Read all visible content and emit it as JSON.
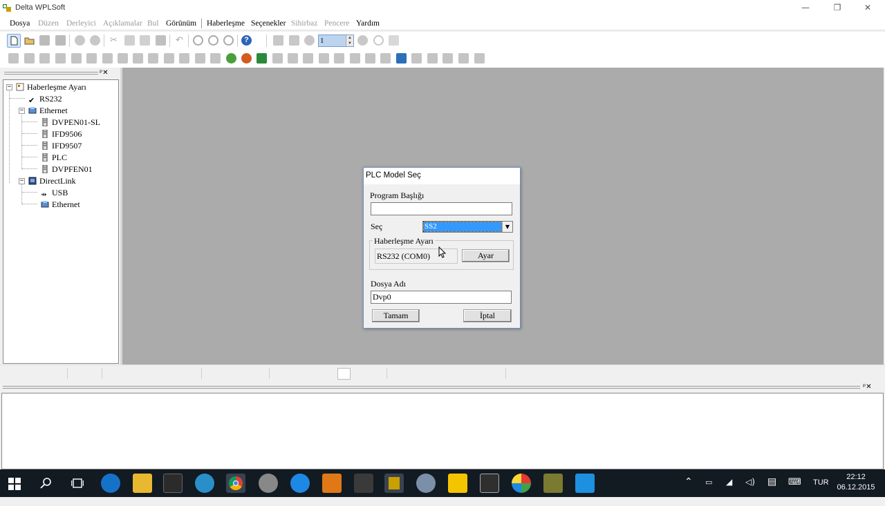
{
  "window": {
    "title": "Delta WPLSoft",
    "minimize": "—",
    "restore": "❐",
    "close": "✕"
  },
  "menubar": [
    {
      "label": "Dosya",
      "enabled": true
    },
    {
      "label": "Düzen",
      "enabled": false
    },
    {
      "label": "Derleyici",
      "enabled": false
    },
    {
      "label": "Açıklamalar",
      "enabled": false
    },
    {
      "label": "Bul",
      "enabled": false
    },
    {
      "label": "Görünüm",
      "enabled": true
    },
    {
      "label": "Haberleşme",
      "enabled": true
    },
    {
      "label": "Seçenekler",
      "enabled": true
    },
    {
      "label": "Sihirbaz",
      "enabled": false
    },
    {
      "label": "Pencere",
      "enabled": false
    },
    {
      "label": "Yardım",
      "enabled": true
    }
  ],
  "toolbar": {
    "spin_value": "1",
    "help_icon": "?"
  },
  "left_pane": {
    "pin": "ᵖ✕",
    "tree": {
      "root": "Haberleşme Ayarı",
      "rs232": "RS232",
      "ethernet": "Ethernet",
      "ethernet_children": [
        "DVPEN01-SL",
        "IFD9506",
        "IFD9507",
        "PLC",
        "DVPFEN01"
      ],
      "directlink": "DirectLink",
      "directlink_children": [
        "USB",
        "Ethernet"
      ]
    }
  },
  "output_pane": {
    "pin": "ᵖ✕"
  },
  "dialog": {
    "title": "PLC Model Seç",
    "program_title_label": "Program Başlığı",
    "program_title_value": "",
    "select_label": "Seç",
    "select_value": "SS2",
    "comm_group_label": "Haberleşme Ayarı",
    "comm_value": "RS232 (COM0)",
    "setup_button": "Ayar",
    "file_name_label": "Dosya Adı",
    "file_name_value": "Dvp0",
    "ok_button": "Tamam",
    "cancel_button": "İptal"
  },
  "taskbar": {
    "language": "TUR",
    "time": "22:12",
    "date": "06.12.2015"
  },
  "colors": {
    "selection": "#3399ff",
    "workarea": "#ababab",
    "taskbar": "#121a22"
  }
}
